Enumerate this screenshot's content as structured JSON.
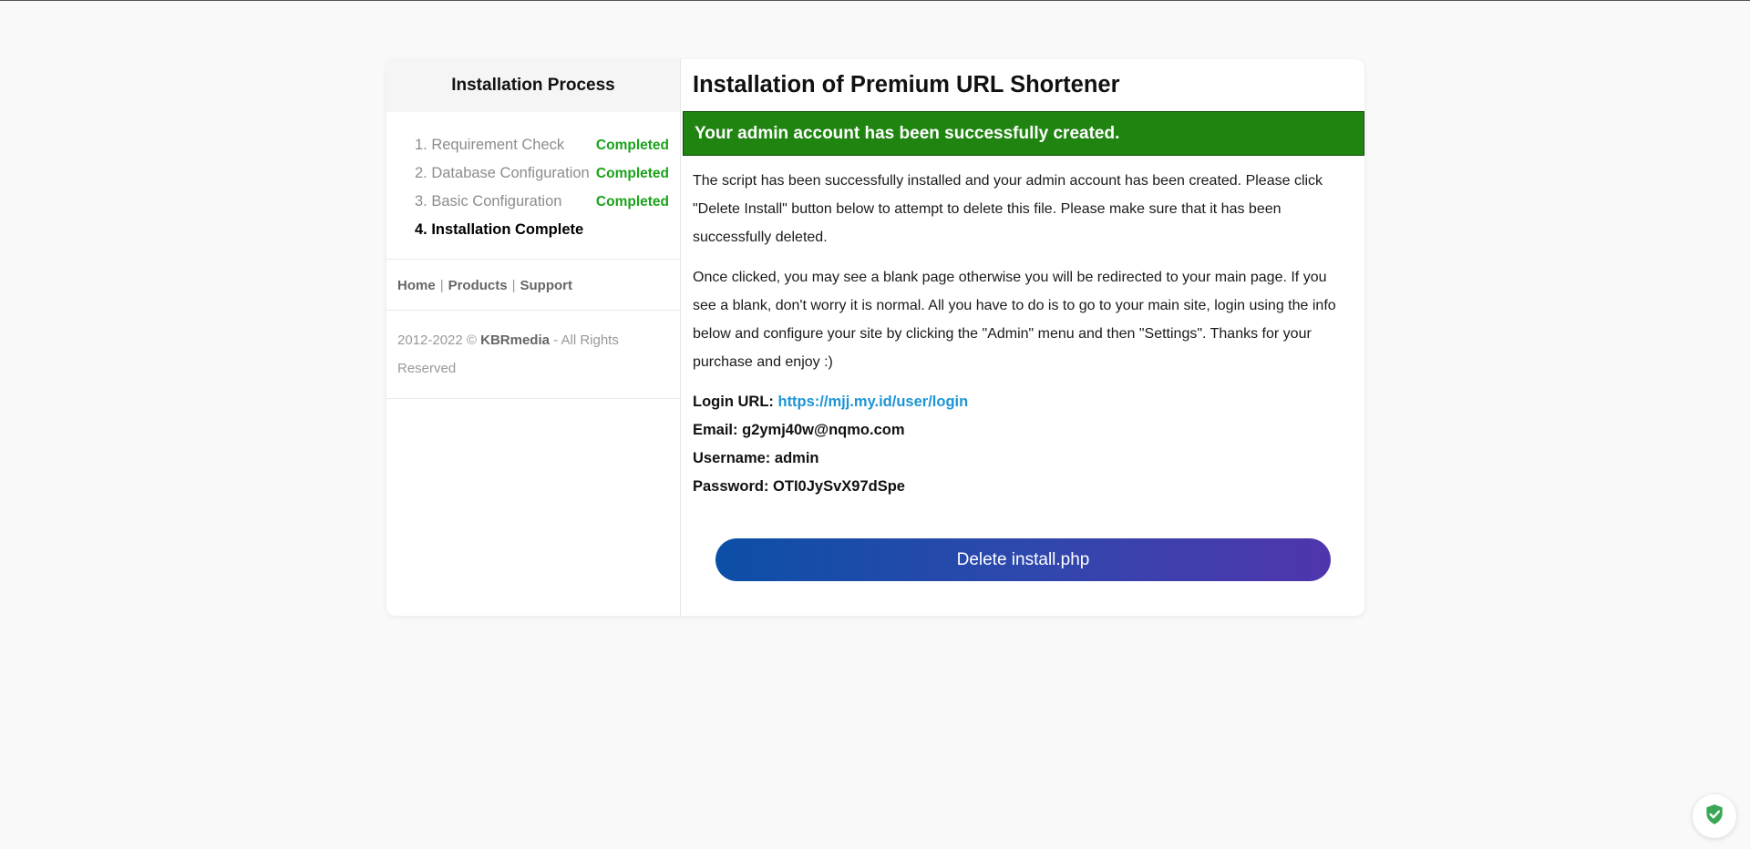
{
  "sidebar": {
    "title": "Installation Process",
    "steps": [
      {
        "label": "1. Requirement Check",
        "status": "Completed"
      },
      {
        "label": "2. Database Configuration",
        "status": "Completed"
      },
      {
        "label": "3. Basic Configuration",
        "status": "Completed"
      },
      {
        "label": "4. Installation Complete",
        "status": ""
      }
    ],
    "links": {
      "home": "Home",
      "products": "Products",
      "support": "Support",
      "separator": "|"
    },
    "footer": {
      "years": "2012-2022 ©",
      "brand": "KBRmedia",
      "rights": "- All Rights Reserved"
    }
  },
  "main": {
    "title": "Installation of Premium URL Shortener",
    "banner": "Your admin account has been successfully created.",
    "paragraph1": "The script has been successfully installed and your admin account has been created. Please click \"Delete Install\" button below to attempt to delete this file. Please make sure that it has been successfully deleted.",
    "paragraph2": "Once clicked, you may see a blank page otherwise you will be redirected to your main page. If you see a blank, don't worry it is normal. All you have to do is to go to your main site, login using the info below and configure your site by clicking the \"Admin\" menu and then \"Settings\". Thanks for your purchase and enjoy :)",
    "login_url_label": "Login URL:",
    "login_url": "https://mjj.my.id/user/login",
    "email_label": "Email:",
    "email": "g2ymj40w@nqmo.com",
    "username_label": "Username:",
    "username": "admin",
    "password_label": "Password:",
    "password": "OTI0JySvX97dSpe",
    "delete_button": "Delete install.php"
  },
  "colors": {
    "success_green": "#1f8410",
    "status_green": "#1aa31a",
    "link_blue": "#1c95d6",
    "button_gradient_start": "#0c4fa7",
    "button_gradient_end": "#5035ad"
  },
  "icons": {
    "security_badge": "shield-check-icon"
  }
}
